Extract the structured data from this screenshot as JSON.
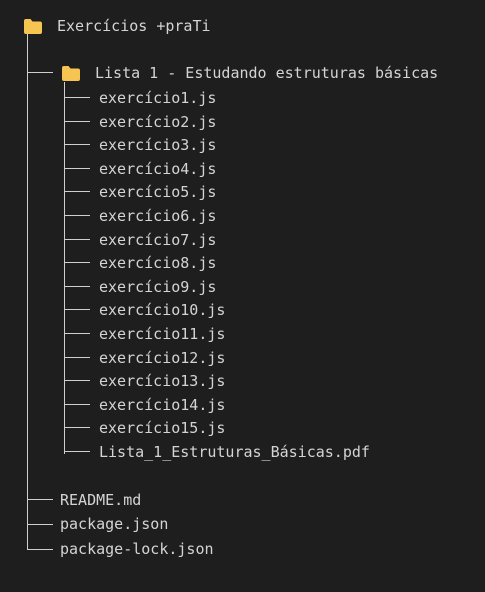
{
  "tree": {
    "root": {
      "icon": "folder-icon",
      "label": "Exercícios +praTi"
    },
    "folder": {
      "icon": "folder-icon",
      "label": "Lista 1 - Estudando estruturas básicas"
    },
    "folder_files": [
      "exercício1.js",
      "exercício2.js",
      "exercício3.js",
      "exercício4.js",
      "exercício5.js",
      "exercício6.js",
      "exercício7.js",
      "exercício8.js",
      "exercício9.js",
      "exercício10.js",
      "exercício11.js",
      "exercício12.js",
      "exercício13.js",
      "exercício14.js",
      "exercício15.js",
      "Lista_1_Estruturas_Básicas.pdf"
    ],
    "root_files": [
      "README.md",
      "package.json",
      "package-lock.json"
    ]
  },
  "colors": {
    "background": "#1e1e1e",
    "text": "#d4d4d4",
    "folder": "#f5c451",
    "lines": "#cfcfcf"
  }
}
